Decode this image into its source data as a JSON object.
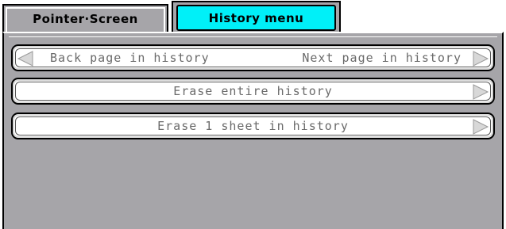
{
  "tabs": [
    {
      "label": "Pointer·Screen",
      "active": false
    },
    {
      "label": "History menu",
      "active": true
    }
  ],
  "history": {
    "back_label": "Back page in history",
    "next_label": "Next page in history",
    "erase_all_label": "Erase entire history",
    "erase_one_label": "Erase 1 sheet in history"
  },
  "icons": {
    "left": "left-triangle-icon",
    "right": "right-triangle-icon"
  },
  "colors": {
    "panel_bg": "#a6a5a9",
    "active_tab": "#00f0f8",
    "button_bg": "#ffffff",
    "button_text": "#6a6a6a",
    "arrow_fill": "#d8d8d8"
  }
}
